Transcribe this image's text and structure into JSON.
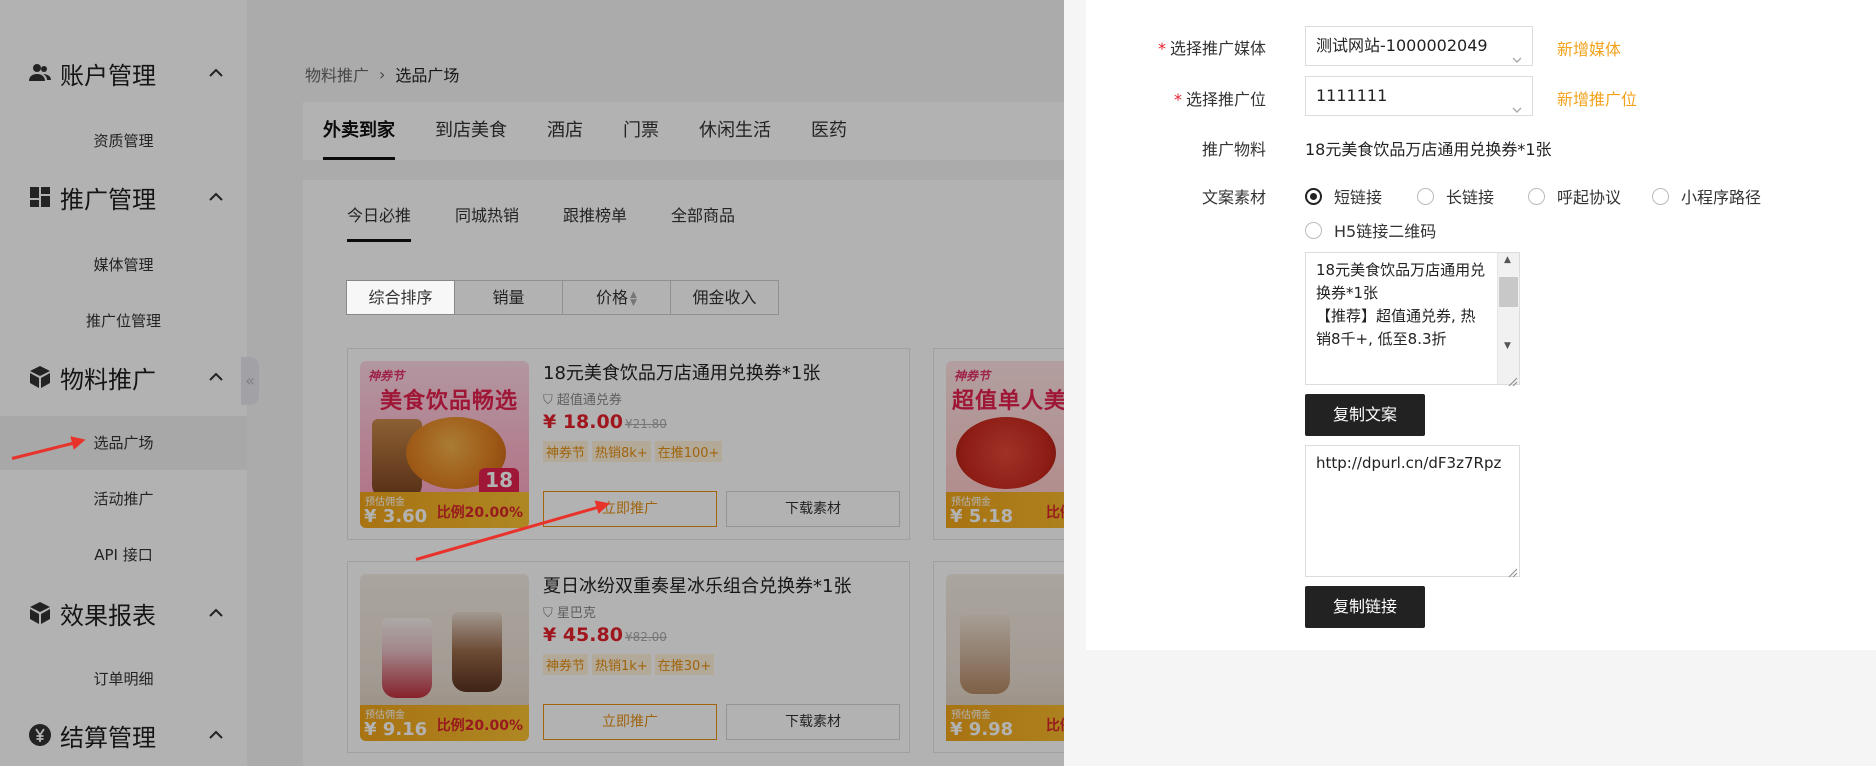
{
  "sidebar": {
    "groups": [
      {
        "label": "账户管理",
        "icon": "users-icon"
      },
      {
        "label": "推广管理",
        "icon": "grid-icon"
      },
      {
        "label": "物料推广",
        "icon": "cube-icon"
      },
      {
        "label": "效果报表",
        "icon": "cube-icon"
      },
      {
        "label": "结算管理",
        "icon": "yen-circle-icon"
      }
    ],
    "items": [
      "资质管理",
      "媒体管理",
      "推广位管理",
      "选品广场",
      "活动推广",
      "API 接口",
      "订单明细"
    ],
    "collapse_glyph": "«"
  },
  "breadcrumb": {
    "parent": "物料推广",
    "separator": "›",
    "current": "选品广场"
  },
  "category_tabs": [
    "外卖到家",
    "到店美食",
    "酒店",
    "门票",
    "休闲生活",
    "医药"
  ],
  "sub_tabs": [
    "今日必推",
    "同城热销",
    "跟推榜单",
    "全部商品"
  ],
  "sort_buttons": [
    "综合排序",
    "销量",
    "价格",
    "佣金收入"
  ],
  "cards": [
    {
      "thumb_tag": "神券节",
      "thumb_headline": "美食饮品畅选",
      "thumb_badge": "18",
      "title": "18元美食饮品万店通用兑换券*1张",
      "brand": "超值通兑券",
      "price": "¥ 18.00",
      "old_price": "¥21.80",
      "badges": [
        "神券节",
        "热销8k+",
        "在推100+"
      ],
      "commission_label": "预估佣金",
      "commission": "¥ 3.60",
      "ratio": "比例20.00%",
      "promote_label": "立即推广",
      "download_label": "下载素材"
    },
    {
      "title": "夏日冰纷双重奏星冰乐组合兑换券*1张",
      "brand": "星巴克",
      "price": "¥ 45.80",
      "old_price": "¥82.00",
      "badges": [
        "神券节",
        "热销1k+",
        "在推30+"
      ],
      "commission_label": "预估佣金",
      "commission": "¥ 9.16",
      "ratio": "比例20.00%",
      "promote_label": "立即推广",
      "download_label": "下载素材"
    }
  ],
  "side_cards": [
    {
      "thumb_tag": "神券节",
      "thumb_headline": "超值单人美",
      "commission_label": "预估佣金",
      "commission": "¥ 5.18",
      "ratio": "比例"
    },
    {
      "commission_label": "预估佣金",
      "commission": "¥ 9.98",
      "ratio": "比例"
    }
  ],
  "drawer": {
    "media_label": "选择推广媒体",
    "media_value": "测试网站-1000002049",
    "media_add": "新增媒体",
    "slot_label": "选择推广位",
    "slot_value": "1111111",
    "slot_add": "新增推广位",
    "material_label": "推广物料",
    "material_value": "18元美食饮品万店通用兑换券*1张",
    "copy_label": "文案素材",
    "radio_options": [
      "短链接",
      "长链接",
      "呼起协议",
      "小程序路径",
      "H5链接二维码"
    ],
    "copy_text": "18元美食饮品万店通用兑换券*1张\n【推荐】超值通兑券, 热销8千+, 低至8.3折",
    "copy_button": "复制文案",
    "link_text": "http://dpurl.cn/dF3z7Rpz",
    "link_button": "复制链接"
  },
  "colors": {
    "accent": "#f2a21b",
    "price": "#e4202c",
    "annotation": "#e8332b",
    "dark_button": "#222222"
  }
}
